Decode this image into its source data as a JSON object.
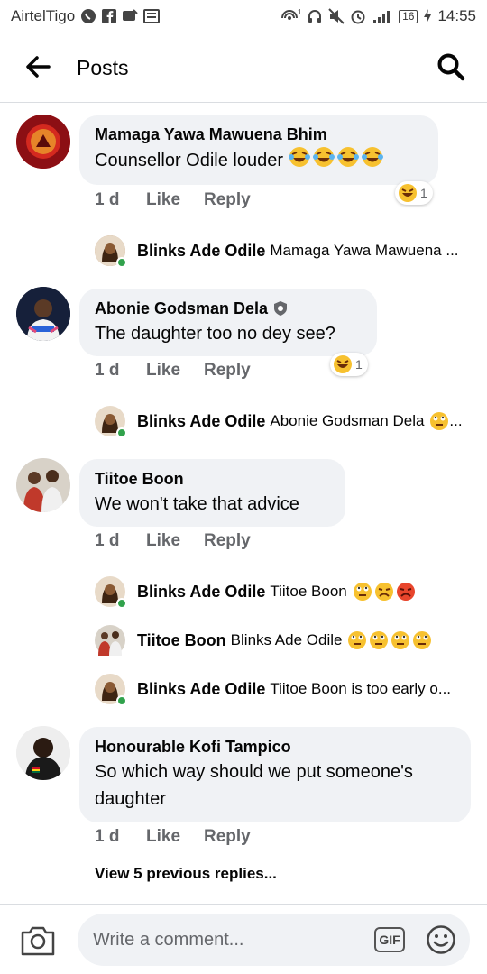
{
  "status_bar": {
    "carrier": "AirtelTigo",
    "battery": "16",
    "time": "14:55"
  },
  "app_bar": {
    "title": "Posts"
  },
  "comments": [
    {
      "author": "Mamaga Yawa Mawuena Bhim",
      "text": "Counsellor  Odile louder",
      "emoji": "rolling-on-floor-laughing-x4",
      "time": "1 d",
      "like_label": "Like",
      "reply_label": "Reply",
      "reaction_count": "1"
    },
    {
      "author": "Abonie Godsman Dela",
      "text": "The daughter too no dey see?",
      "time": "1 d",
      "like_label": "Like",
      "reply_label": "Reply",
      "reaction_count": "1"
    },
    {
      "author": "Tiitoe Boon",
      "text": "We won't take that advice",
      "time": "1 d",
      "like_label": "Like",
      "reply_label": "Reply"
    },
    {
      "author": "Honourable Kofi Tampico",
      "text": "So which way should we put someone's daughter",
      "time": "1 d",
      "like_label": "Like",
      "reply_label": "Reply"
    }
  ],
  "replies": [
    {
      "author": "Blinks Ade Odile",
      "text": "Mamaga Yawa Mawuena ..."
    },
    {
      "author": "Blinks Ade Odile",
      "text": "Abonie Godsman Dela"
    },
    {
      "author": "Blinks Ade Odile",
      "text": "Tiitoe Boon"
    },
    {
      "author": "Tiitoe Boon",
      "text": "Blinks Ade Odile"
    },
    {
      "author": "Blinks Ade Odile",
      "text": "Tiitoe Boon is too early o..."
    }
  ],
  "view_previous": "View 5 previous replies...",
  "composer": {
    "placeholder": "Write a comment...",
    "gif_label": "GIF"
  },
  "colors": {
    "bubble": "#f0f2f5",
    "secondary_text": "#65676b",
    "online": "#31a24c",
    "emoji_yellow": "#f7c12f"
  }
}
